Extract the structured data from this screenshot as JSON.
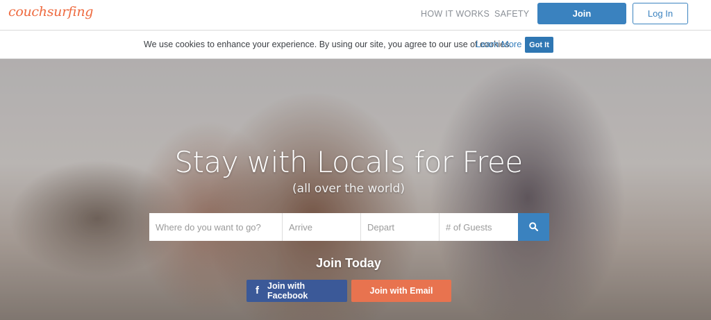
{
  "header": {
    "logo": "couchsurfing",
    "nav": [
      "HOW IT WORKS",
      "SAFETY"
    ],
    "join_label": "Join",
    "login_label": "Log In"
  },
  "cookie_bar": {
    "message": "We use cookies to enhance your experience. By using our site, you agree to our use of cookies.",
    "learn_more": "Learn More",
    "button": "Got It"
  },
  "hero": {
    "title": "Stay with Locals for Free",
    "subtitle": "(all over the world)",
    "search": {
      "where_placeholder": "Where do you want to go?",
      "arrive_placeholder": "Arrive",
      "depart_placeholder": "Depart",
      "guests_placeholder": "# of Guests",
      "icon": "search-icon"
    },
    "join_heading": "Join Today",
    "facebook_label": "Join with Facebook",
    "facebook_icon": "f",
    "email_label": "Join with Email"
  },
  "colors": {
    "brand": "#ee6a3f",
    "primary": "#3a82bf",
    "facebook": "#3b5998",
    "email": "#e8734f"
  }
}
